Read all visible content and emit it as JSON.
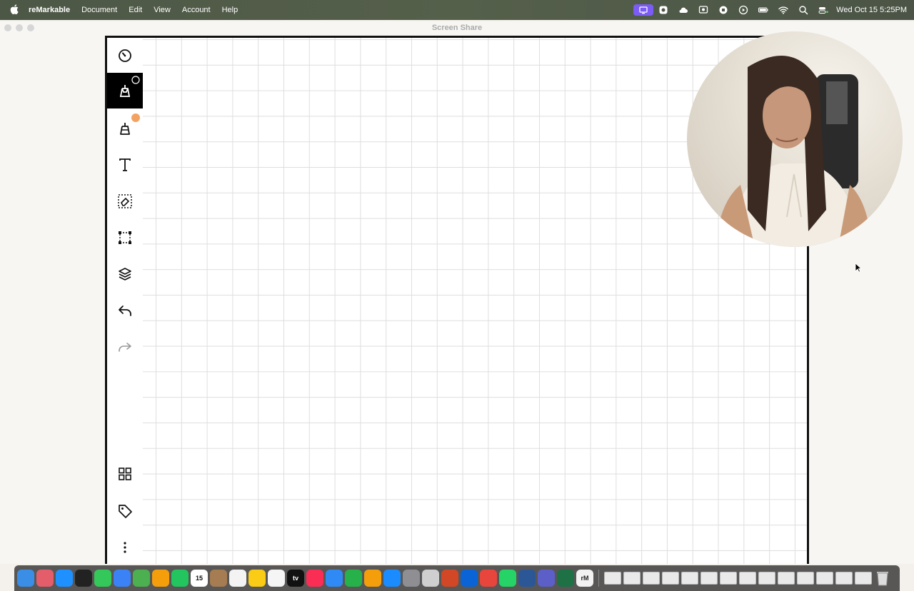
{
  "menubar": {
    "app_name": "reMarkable",
    "menus": [
      "Document",
      "Edit",
      "View",
      "Account",
      "Help"
    ],
    "clock": "Wed Oct 15  5:25PM",
    "status_icons": [
      "screen-share-icon",
      "camera-icon",
      "cloud-icon",
      "remote-icon",
      "gpu-icon",
      "play-icon",
      "battery-icon",
      "wifi-icon",
      "search-icon",
      "control-center-icon"
    ],
    "active_color": "#7b5cf5"
  },
  "window": {
    "title": "Screen Share"
  },
  "toolbar": {
    "tools": [
      {
        "name": "menu-circle-icon"
      },
      {
        "name": "pen-tool-icon",
        "selected": true
      },
      {
        "name": "highlighter-tool-icon",
        "badge_color": "#f4a261"
      },
      {
        "name": "text-tool-icon",
        "glyph": "T"
      },
      {
        "name": "eraser-tool-icon"
      },
      {
        "name": "selection-tool-icon"
      },
      {
        "name": "layers-icon"
      },
      {
        "name": "undo-icon"
      },
      {
        "name": "redo-icon"
      }
    ],
    "bottom_tools": [
      "page-overview-icon",
      "tag-icon",
      "more-icon"
    ]
  },
  "dock": {
    "apps": [
      {
        "name": "finder-icon",
        "color": "#3a8ee6"
      },
      {
        "name": "launchpad-icon",
        "color": "#e35d6a"
      },
      {
        "name": "safari-icon",
        "color": "#1e90ff"
      },
      {
        "name": "terminal-icon",
        "color": "#222222"
      },
      {
        "name": "messages-icon",
        "color": "#34c759"
      },
      {
        "name": "mail-icon",
        "color": "#3b82f6"
      },
      {
        "name": "maps-icon",
        "color": "#4caf50"
      },
      {
        "name": "photos-icon",
        "color": "#f59e0b"
      },
      {
        "name": "facetime-icon",
        "color": "#22c55e"
      },
      {
        "name": "calendar-icon",
        "color": "#ffffff",
        "label": "15"
      },
      {
        "name": "contacts-icon",
        "color": "#a67c52"
      },
      {
        "name": "reminders-icon",
        "color": "#f3f3f3"
      },
      {
        "name": "notes-icon",
        "color": "#facc15"
      },
      {
        "name": "freeform-icon",
        "color": "#f5f5f5"
      },
      {
        "name": "tv-icon",
        "color": "#111111",
        "label": "tv"
      },
      {
        "name": "music-icon",
        "color": "#fa2d55"
      },
      {
        "name": "keynote-icon",
        "color": "#2f8af5"
      },
      {
        "name": "numbers-icon",
        "color": "#26b14b"
      },
      {
        "name": "pages-icon",
        "color": "#f59e0b"
      },
      {
        "name": "app-store-icon",
        "color": "#1a8cff"
      },
      {
        "name": "system-settings-icon",
        "color": "#8e8e93"
      },
      {
        "name": "iphone-mirroring-icon",
        "color": "#cfcfcf"
      },
      {
        "name": "powerpoint-icon",
        "color": "#d24726"
      },
      {
        "name": "outlook-icon",
        "color": "#0a64d6"
      },
      {
        "name": "chrome-icon",
        "color": "#e8453c"
      },
      {
        "name": "whatsapp-icon",
        "color": "#25d366"
      },
      {
        "name": "word-icon",
        "color": "#2b5797"
      },
      {
        "name": "teams-icon",
        "color": "#5b5fc7"
      },
      {
        "name": "excel-icon",
        "color": "#1e7145"
      },
      {
        "name": "remarkable-icon",
        "color": "#f2f2f2",
        "label": "rM"
      }
    ],
    "windows_count": 14
  }
}
